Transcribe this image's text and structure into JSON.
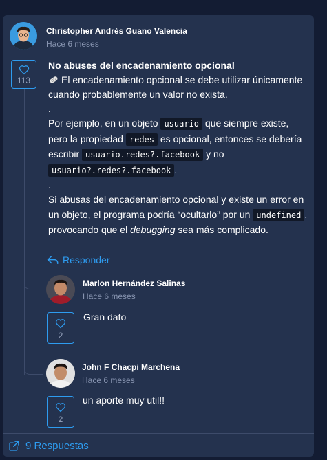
{
  "main_comment": {
    "author": "Christopher Andrés Guano Valencia",
    "time": "Hace 6 meses",
    "likes": "113",
    "title": "No abuses del encadenamiento opcional",
    "p1": "El encadenamiento opcional se debe utilizar únicamente cuando probablemente un valor no exista.",
    "dot1": ".",
    "p2_a": "Por ejemplo, en un objeto",
    "p2_code1": "usuario",
    "p2_b": "que siempre existe, pero la propiedad",
    "p2_code2": "redes",
    "p2_c": "es opcional, entonces se debería escribir",
    "p2_code3": "usuario.redes?.facebook",
    "p2_d": "y no",
    "p2_code4": "usuario?.redes?.facebook",
    "p2_e": ".",
    "dot2": ".",
    "p3_a": "Si abusas del encadenamiento opcional y existe un error en un objeto, el programa podría “ocultarlo” por un",
    "p3_code": "undefined",
    "p3_b": ", provocando que el",
    "p3_em": "debugging",
    "p3_c": "sea más complicado.",
    "reply_label": "Responder",
    "icon": "paperclip-icon"
  },
  "replies": [
    {
      "author": "Marlon Hernández Salinas",
      "time": "Hace 6 meses",
      "text": "Gran dato",
      "likes": "2"
    },
    {
      "author": "John F Chacpi Marchena",
      "time": "Hace 6 meses",
      "text": "un aporte muy util!!",
      "likes": "2"
    }
  ],
  "footer": {
    "label": "9 Respuestas",
    "icon": "external-link-icon"
  },
  "colors": {
    "accent": "#2e9cf0",
    "card": "#24324e",
    "background": "#131c33"
  }
}
